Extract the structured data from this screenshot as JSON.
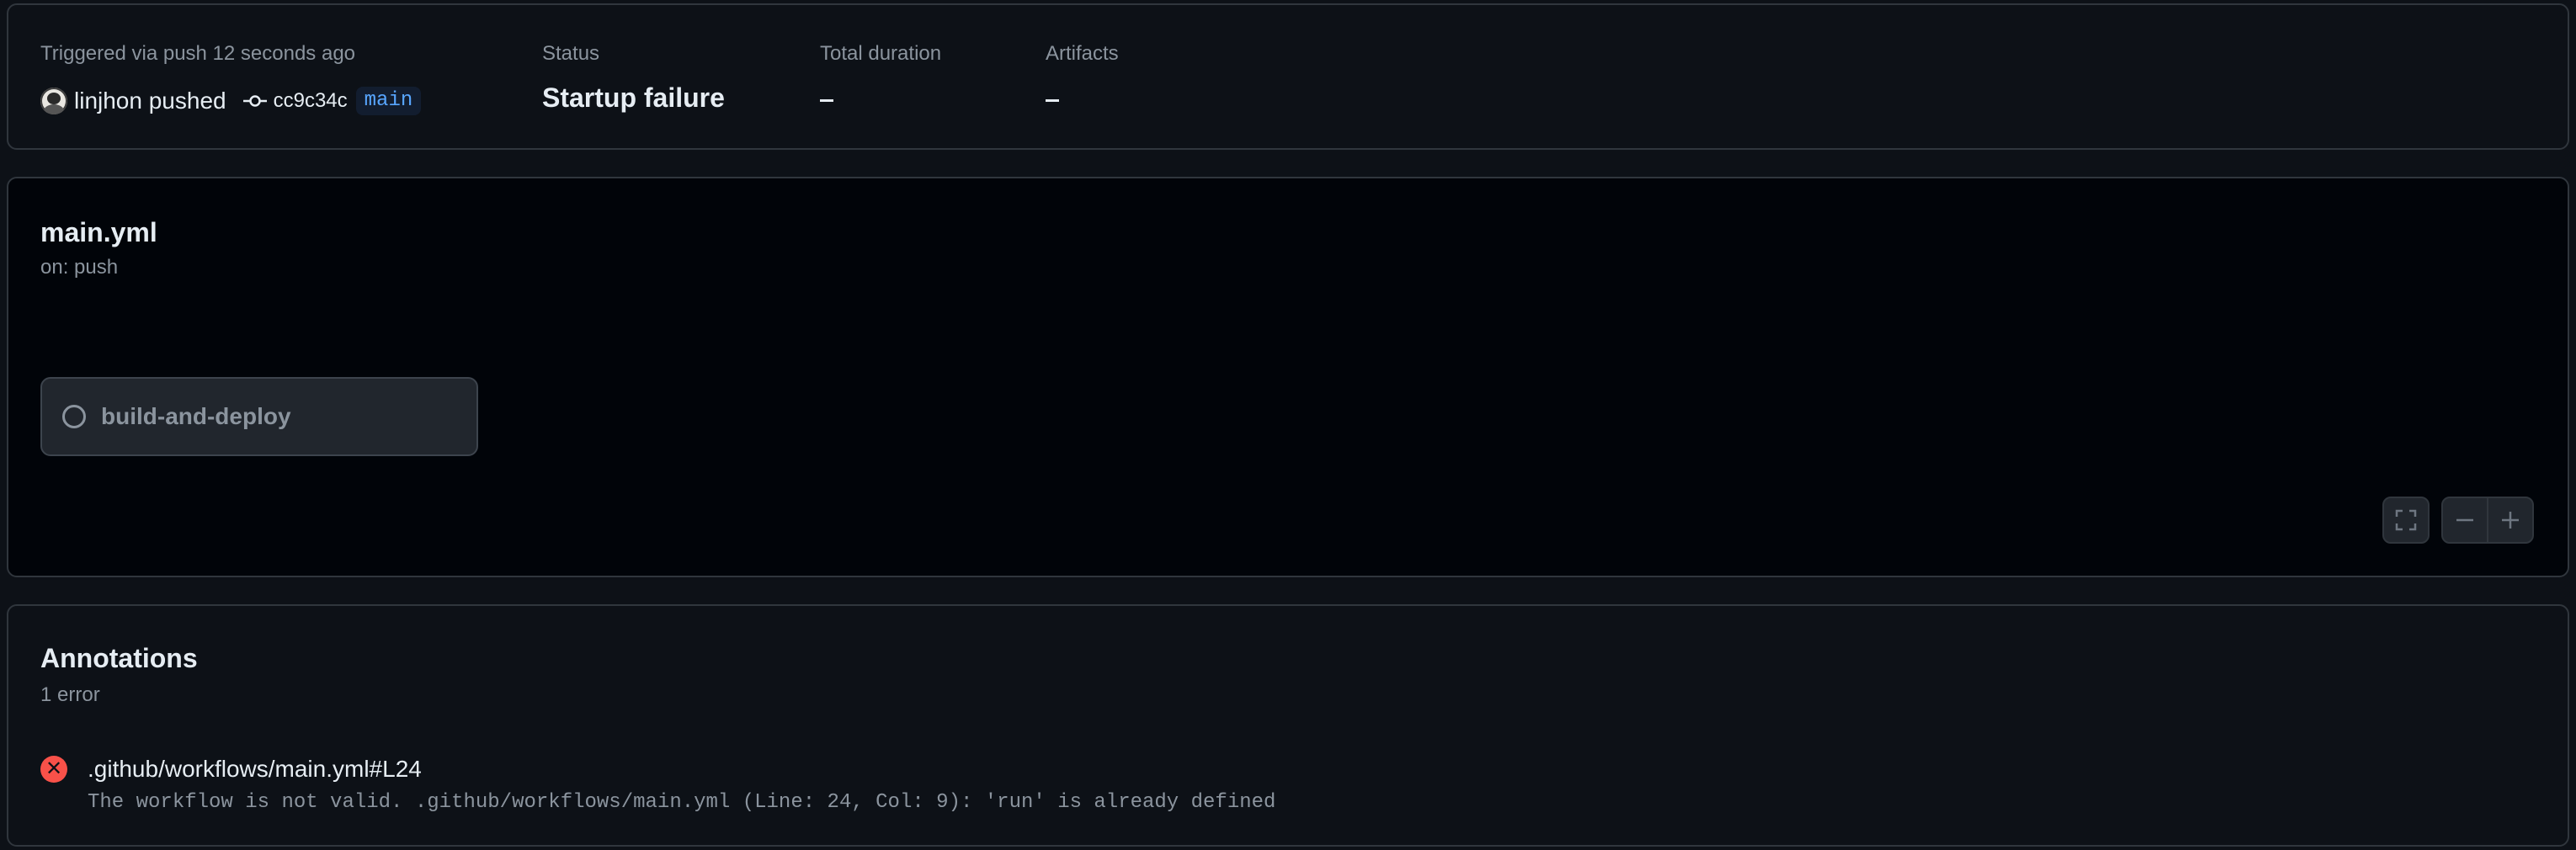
{
  "summary": {
    "trigger_text": "Triggered via push 12 seconds ago",
    "actor": "linjhon pushed",
    "commit_sha": "cc9c34c",
    "branch": "main",
    "status_label": "Status",
    "status_value": "Startup failure",
    "duration_label": "Total duration",
    "artifacts_label": "Artifacts"
  },
  "workflow": {
    "file": "main.yml",
    "trigger": "on: push",
    "job": {
      "name": "build-and-deploy",
      "status_icon": "circle-icon"
    },
    "controls": [
      "fullscreen-icon",
      "zoom-out-icon",
      "zoom-in-icon"
    ]
  },
  "annotations": {
    "title": "Annotations",
    "count": "1 error",
    "items": [
      {
        "severity_icon": "error-x-circle-icon",
        "location": ".github/workflows/main.yml#L24",
        "message": "The workflow is not valid. .github/workflows/main.yml (Line: 24, Col: 9): 'run' is already defined"
      }
    ]
  },
  "colors": {
    "background": "#0d1117",
    "border": "#30363d",
    "error": "#f85149",
    "branch_text": "#58a6ff",
    "muted_text": "#8b949e"
  }
}
